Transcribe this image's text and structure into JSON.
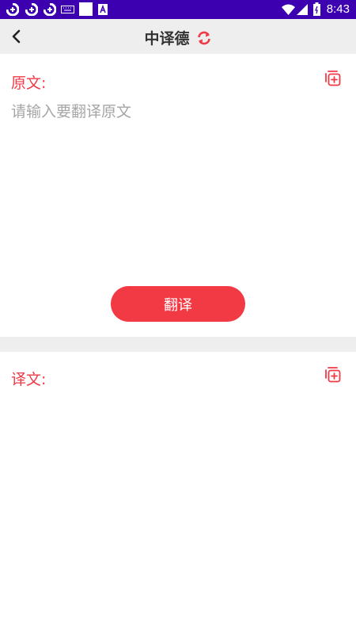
{
  "status_bar": {
    "time": "8:43",
    "icons": [
      "sync-icon",
      "sync-icon",
      "sync-icon",
      "keyboard-icon",
      "square-icon",
      "a-icon",
      "wifi-icon",
      "signal-icon",
      "battery-icon"
    ],
    "bg_color": "#3d00b0"
  },
  "header": {
    "title": "中译德",
    "back_icon": "chevron-left-icon",
    "swap_icon": "swap-refresh-icon"
  },
  "source": {
    "label": "原文:",
    "placeholder": "请输入要翻译原文",
    "value": "",
    "copy_icon": "copy-add-icon"
  },
  "translate_button": {
    "label": "翻译"
  },
  "output": {
    "label": "译文:",
    "value": "",
    "copy_icon": "copy-add-icon"
  },
  "colors": {
    "accent": "#ef3a47",
    "button": "#f23a45",
    "header_bg": "#eeeeee",
    "placeholder": "#a6a6a6"
  }
}
